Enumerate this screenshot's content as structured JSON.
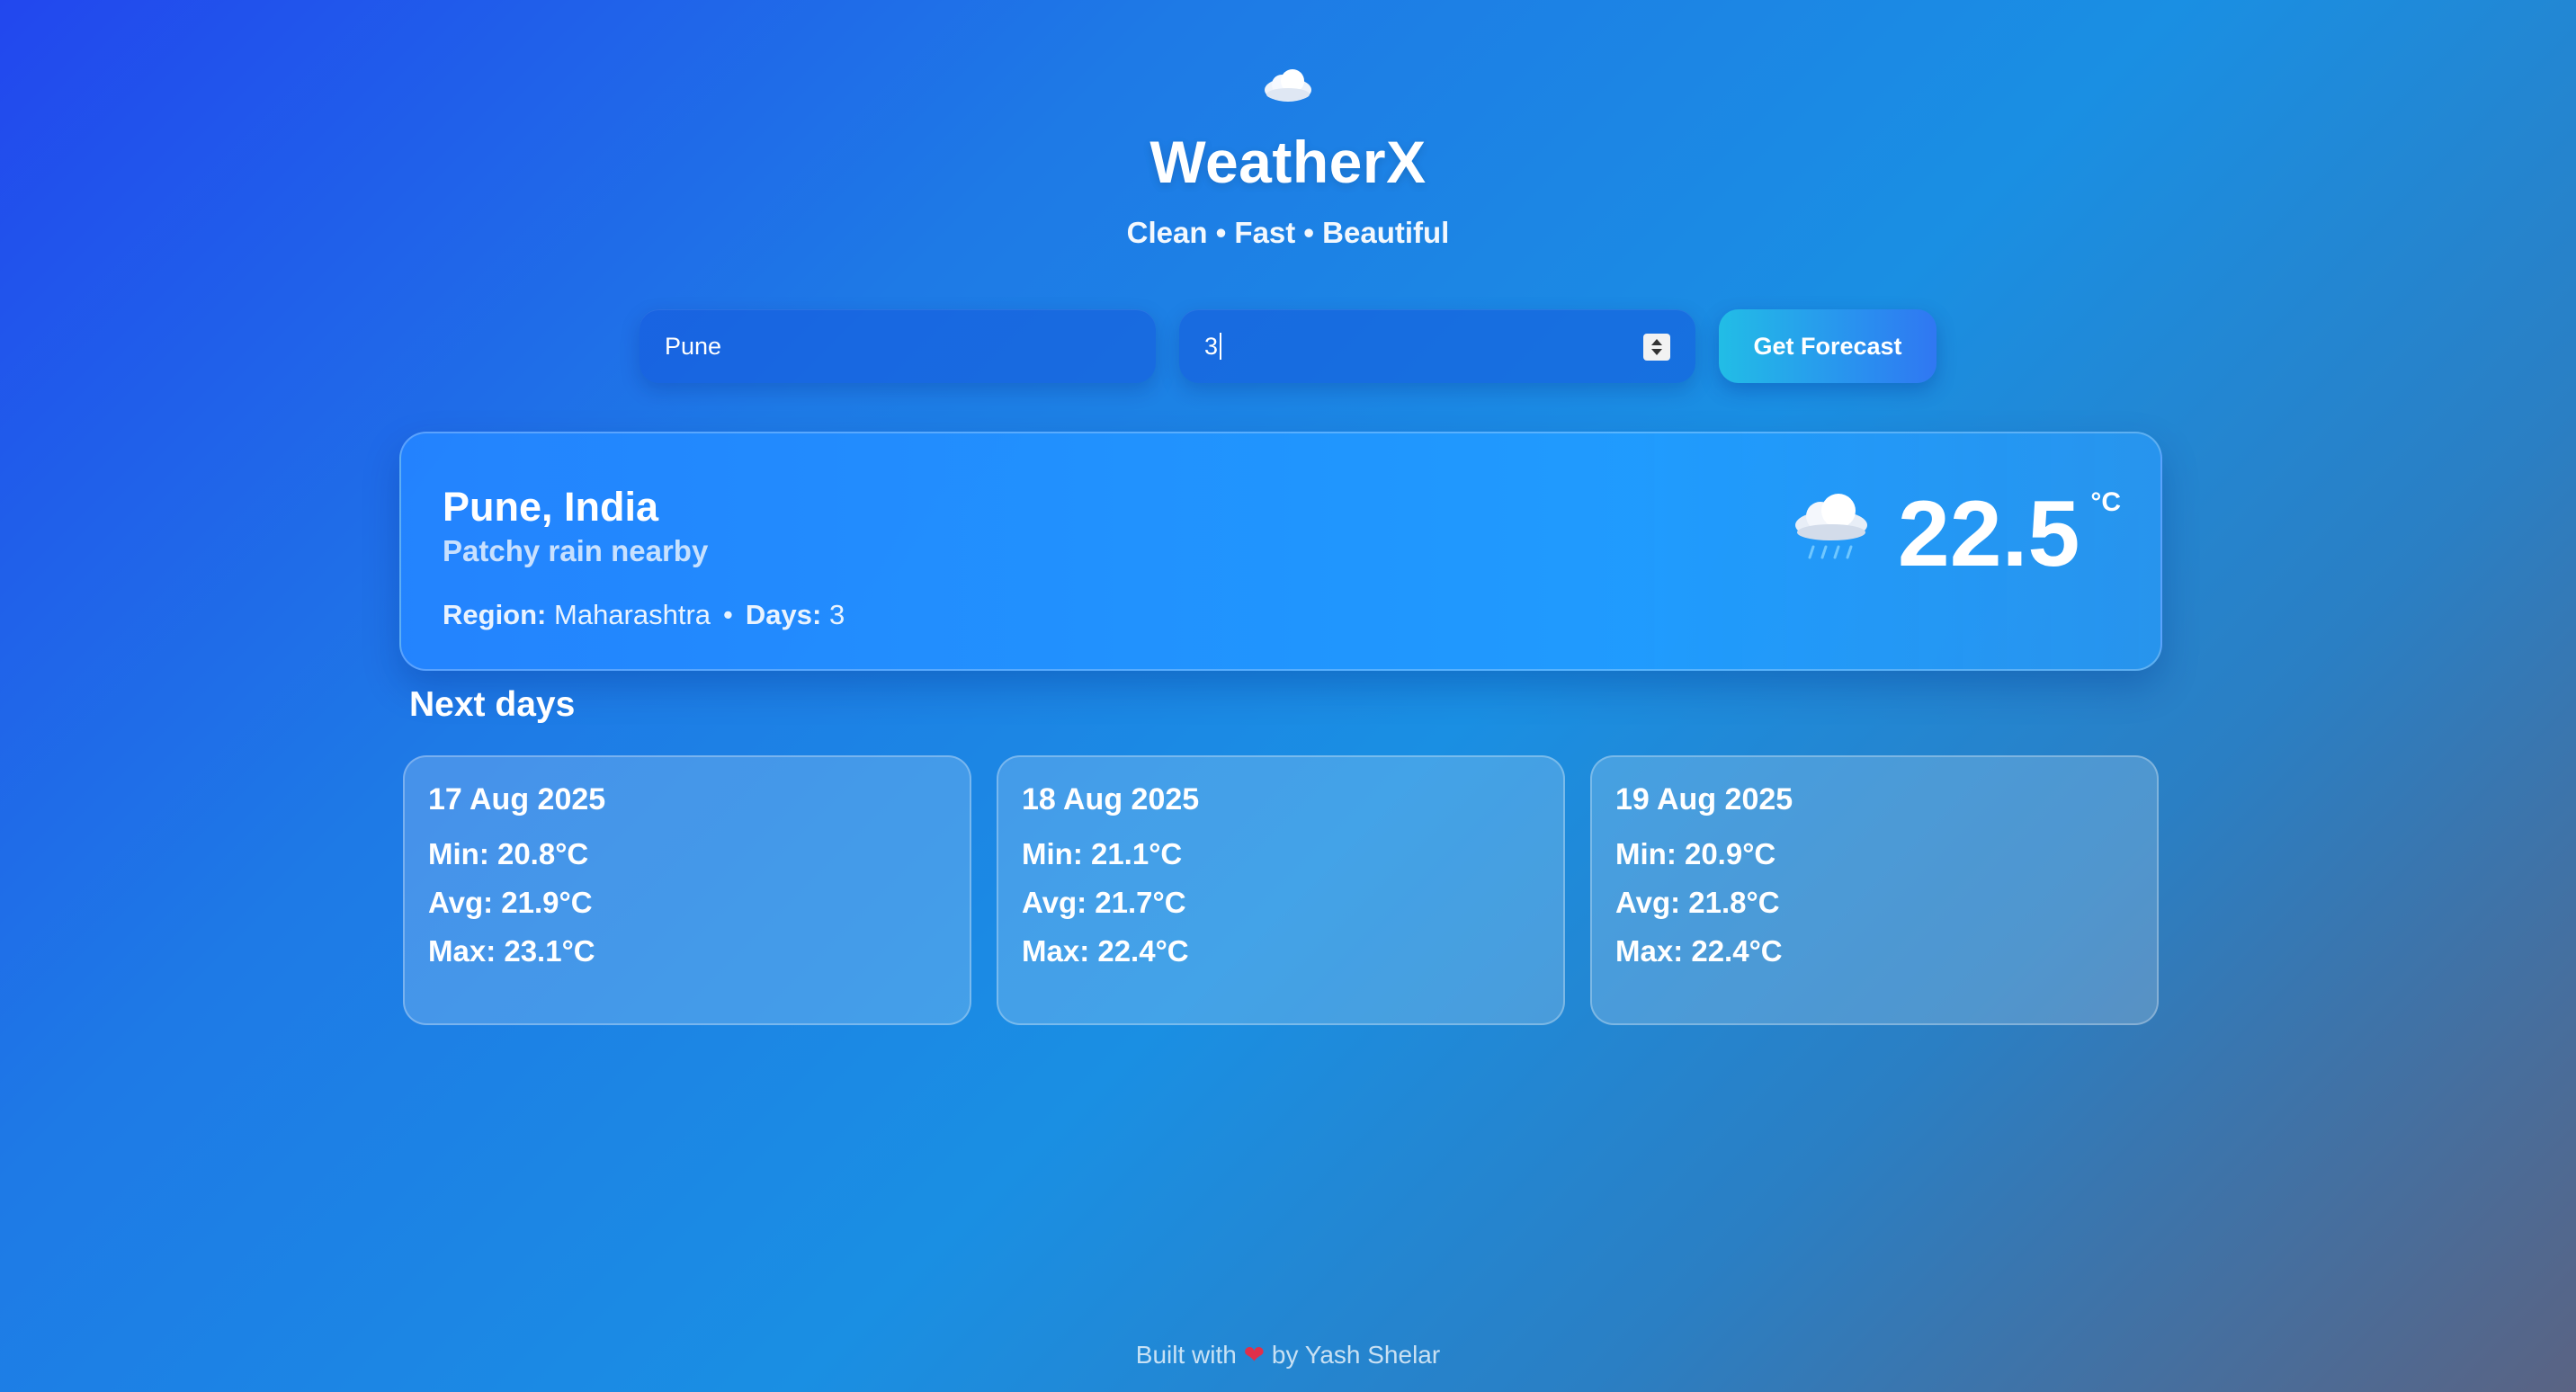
{
  "header": {
    "logo_icon": "cloud-icon",
    "title": "WeatherX",
    "tagline": "Clean • Fast • Beautiful"
  },
  "search": {
    "city_value": "Pune",
    "days_value": "3",
    "button_label": "Get Forecast"
  },
  "current": {
    "location": "Pune, India",
    "condition": "Patchy rain nearby",
    "region_label": "Region:",
    "region_value": "Maharashtra",
    "separator": "•",
    "days_label": "Days:",
    "days_value": "3",
    "icon": "rain-cloud-icon",
    "temperature": "22.5",
    "unit": "°C"
  },
  "forecast": {
    "title": "Next days",
    "days": [
      {
        "date": "17 Aug 2025",
        "min": "Min: 20.8°C",
        "avg": "Avg: 21.9°C",
        "max": "Max: 23.1°C"
      },
      {
        "date": "18 Aug 2025",
        "min": "Min: 21.1°C",
        "avg": "Avg: 21.7°C",
        "max": "Max: 22.4°C"
      },
      {
        "date": "19 Aug 2025",
        "min": "Min: 20.9°C",
        "avg": "Avg: 21.8°C",
        "max": "Max: 22.4°C"
      }
    ]
  },
  "footer": {
    "prefix": "Built with",
    "heart": "❤",
    "suffix": "by Yash Shelar"
  }
}
